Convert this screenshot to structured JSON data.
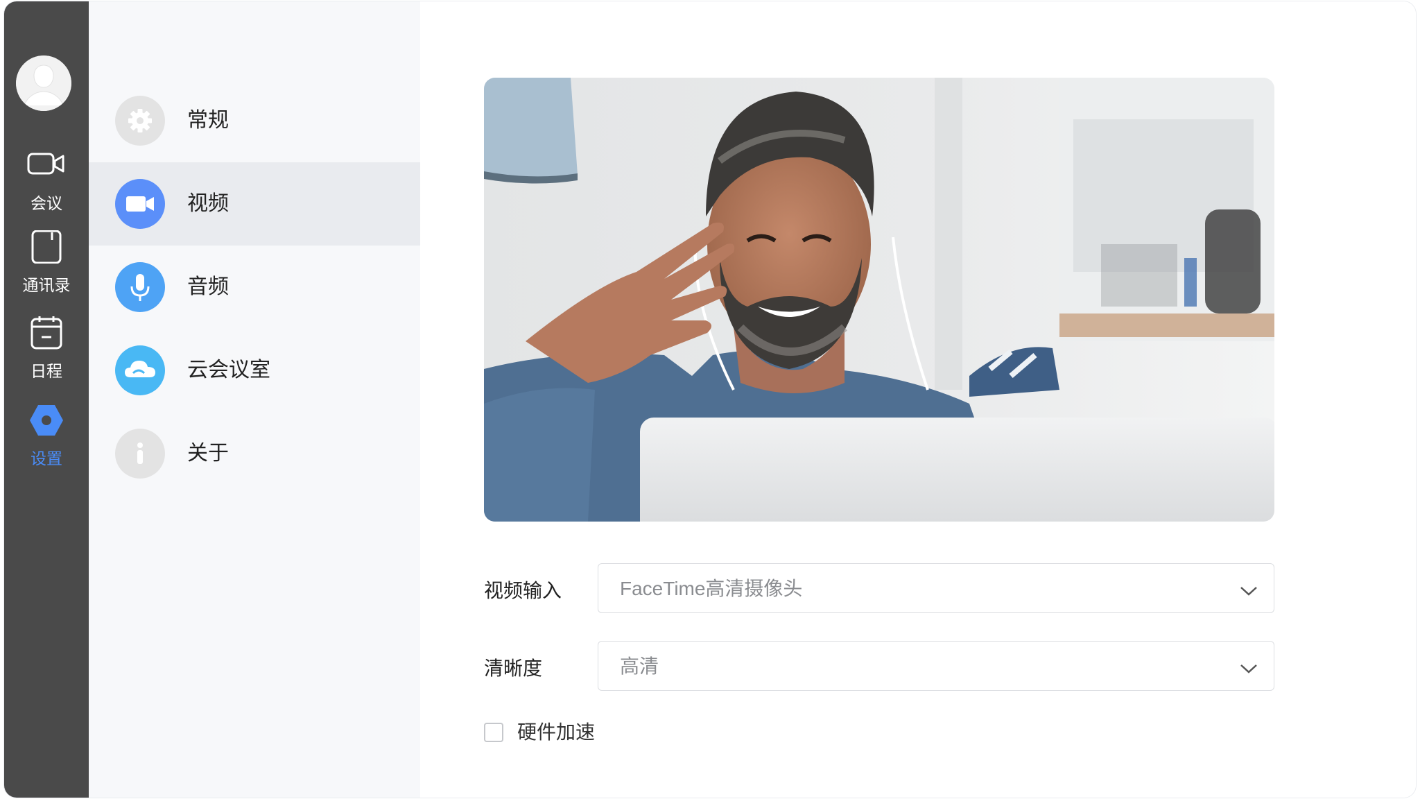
{
  "nav": {
    "avatar_icon": "user-avatar",
    "items": [
      {
        "label": "会议",
        "icon": "video-camera-icon"
      },
      {
        "label": "通讯录",
        "icon": "contacts-book-icon"
      },
      {
        "label": "日程",
        "icon": "calendar-icon"
      },
      {
        "label": "设置",
        "icon": "settings-hexagon-icon",
        "active": true
      }
    ],
    "active_color": "#4a8cf7"
  },
  "settings_menu": {
    "items": [
      {
        "label": "常规",
        "icon": "gear-icon",
        "color": "#e3e3e3"
      },
      {
        "label": "视频",
        "icon": "video-icon",
        "color": "#5b8ff9",
        "active": true
      },
      {
        "label": "音频",
        "icon": "microphone-icon",
        "color": "#4ea3f5"
      },
      {
        "label": "云会议室",
        "icon": "cloud-icon",
        "color": "#49b8f4"
      },
      {
        "label": "关于",
        "icon": "info-icon",
        "color": "#e3e3e3"
      }
    ]
  },
  "video_settings": {
    "input_label": "视频输入",
    "input_value": "FaceTime高清摄像头",
    "resolution_label": "清晰度",
    "resolution_value": "高清",
    "hardware_accel_label": "硬件加速",
    "hardware_accel_checked": false
  }
}
